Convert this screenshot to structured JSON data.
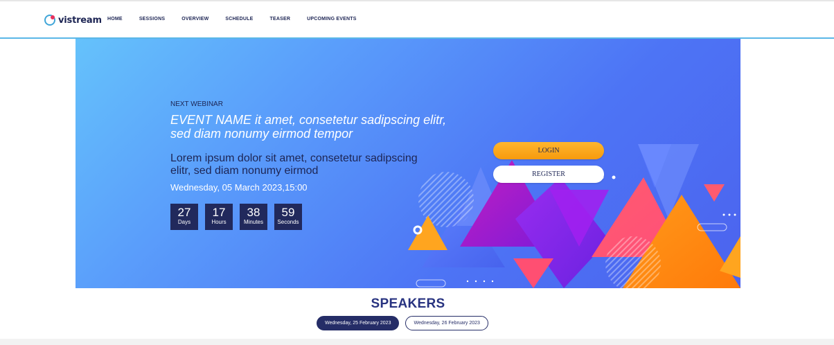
{
  "brand": {
    "name": "vistream",
    "accent": "#3fa5d8",
    "dot_color": "#e9325e"
  },
  "nav": {
    "items": [
      "HOME",
      "SESSIONS",
      "OVERVIEW",
      "SCHEDULE",
      "TEASER",
      "UPCOMING EVENTS"
    ]
  },
  "hero": {
    "label": "NEXT WEBINAR",
    "event_name": "EVENT NAME it amet, consetetur sadipscing elitr, sed diam nonumy eirmod tempor",
    "subtitle": "Lorem ipsum dolor sit amet, consetetur sadipscing elitr, sed diam nonumy eirmod",
    "date": "Wednesday, 05 March 2023,15:00",
    "countdown": [
      {
        "value": "27",
        "unit": "Days"
      },
      {
        "value": "17",
        "unit": "Hours"
      },
      {
        "value": "38",
        "unit": "Minutes"
      },
      {
        "value": "59",
        "unit": "Seconds"
      }
    ],
    "login_label": "LOGIN",
    "register_label": "REGISTER"
  },
  "speakers": {
    "title": "SPEAKERS",
    "tabs": [
      {
        "label": "Wednesday, 25 February 2023",
        "active": true
      },
      {
        "label": "Wednesday, 26 February 2023",
        "active": false
      }
    ]
  }
}
